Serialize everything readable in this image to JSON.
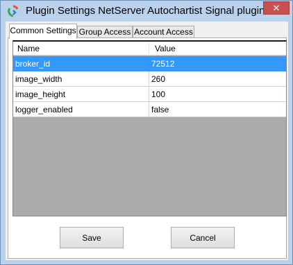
{
  "window": {
    "title": "Plugin Settings NetServer Autochartist Signal plugin",
    "close_glyph": "✕",
    "app_icon": "plugin-logo-icon"
  },
  "tabs": [
    {
      "label": "Common Settings",
      "active": true
    },
    {
      "label": "Group Access",
      "active": false
    },
    {
      "label": "Account Access",
      "active": false
    }
  ],
  "grid": {
    "columns": [
      "Name",
      "Value"
    ],
    "rows": [
      {
        "name": "broker_id",
        "value": "72512",
        "selected": true
      },
      {
        "name": "image_width",
        "value": "260",
        "selected": false
      },
      {
        "name": "image_height",
        "value": "100",
        "selected": false
      },
      {
        "name": "logger_enabled",
        "value": "false",
        "selected": false
      }
    ]
  },
  "buttons": {
    "save_label": "Save",
    "cancel_label": "Cancel"
  },
  "colors": {
    "selection": "#3399ff",
    "titlebar": "#b9d1ea",
    "close_button": "#c75050",
    "grid_background": "#ababab"
  }
}
